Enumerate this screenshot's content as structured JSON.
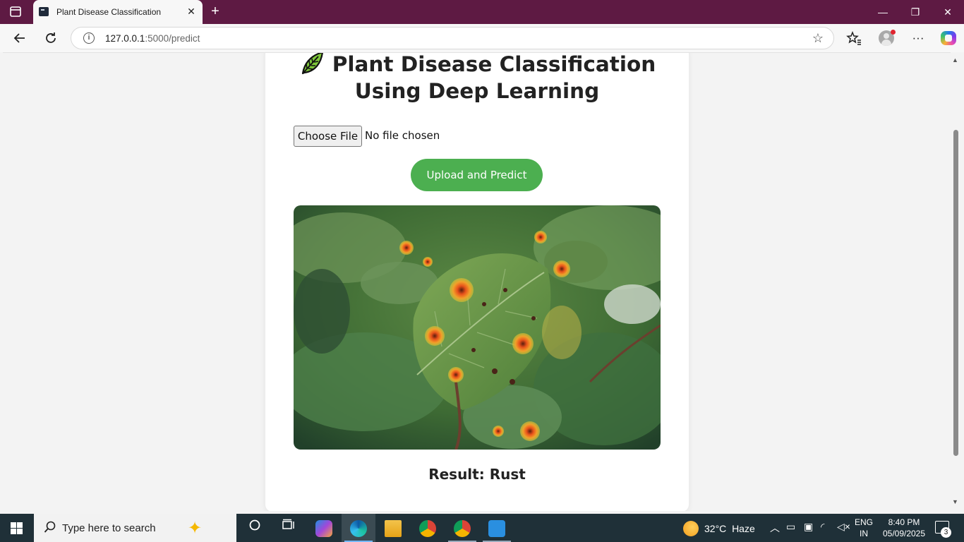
{
  "browser": {
    "tab_title": "Plant Disease Classification",
    "tab_close": "✕",
    "new_tab": "+",
    "url_host": "127.0.0.1",
    "url_path": ":5000/predict",
    "window_controls": {
      "minimize": "—",
      "restore": "❐",
      "close": "✕"
    }
  },
  "page": {
    "title_line1": "Plant Disease Classification",
    "title_line2": "Using Deep Learning",
    "leaf_icon": "leaf-icon",
    "file_button": "Choose File",
    "file_status": "No file chosen",
    "submit_label": "Upload and Predict",
    "result_text": "Result: Rust",
    "accent_color": "#4caf50"
  },
  "taskbar": {
    "search_placeholder": "Type here to search",
    "weather_temp": "32°C",
    "weather_desc": "Haze",
    "lang_line1": "ENG",
    "lang_line2": "IN",
    "time": "8:40 PM",
    "date": "05/09/2025",
    "notification_count": "3"
  }
}
